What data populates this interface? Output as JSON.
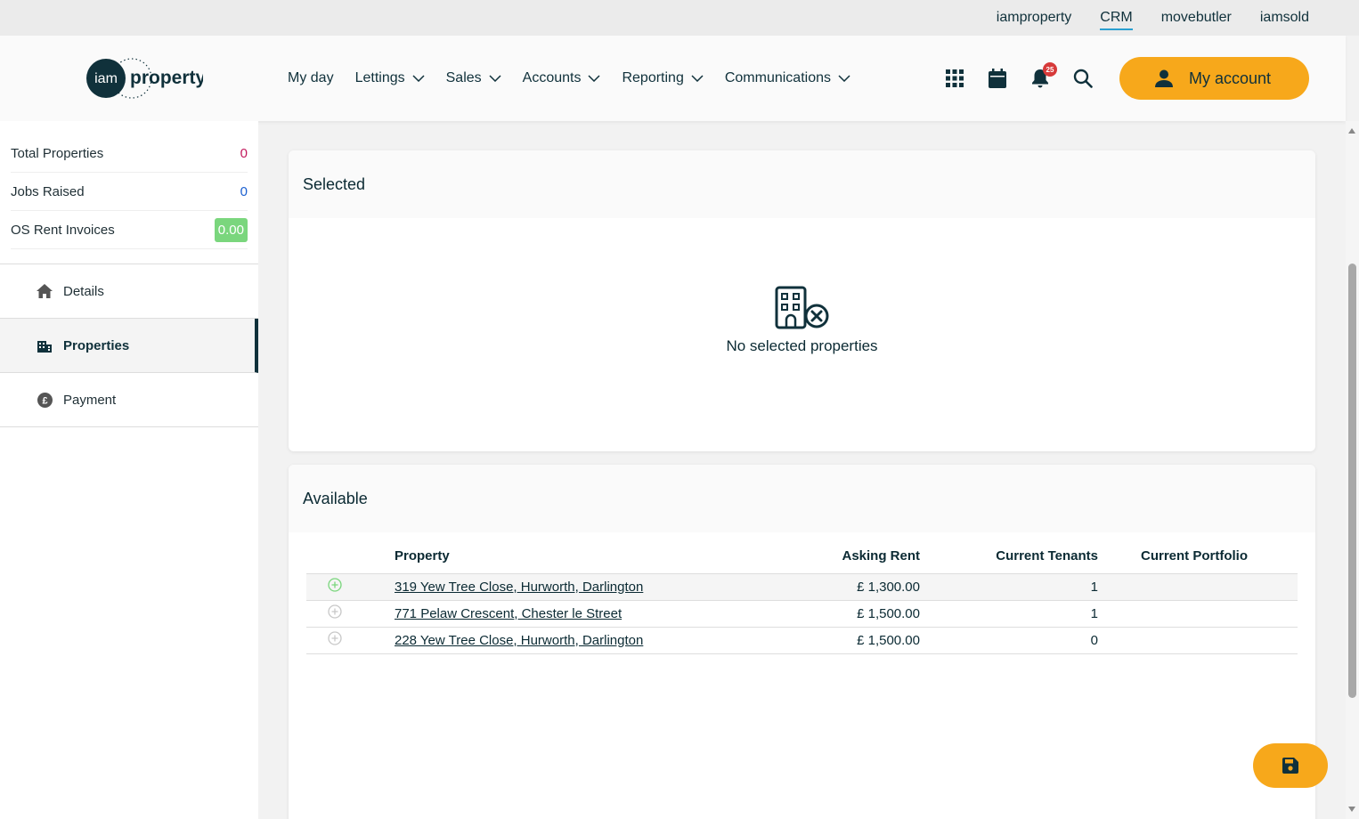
{
  "top_links": [
    {
      "label": "iamproperty",
      "active": false
    },
    {
      "label": "CRM",
      "active": true
    },
    {
      "label": "movebutler",
      "active": false
    },
    {
      "label": "iamsold",
      "active": false
    }
  ],
  "logo": {
    "part1": "iam",
    "part2": "property"
  },
  "nav": [
    {
      "label": "My day",
      "dropdown": false
    },
    {
      "label": "Lettings",
      "dropdown": true
    },
    {
      "label": "Sales",
      "dropdown": true
    },
    {
      "label": "Accounts",
      "dropdown": true
    },
    {
      "label": "Reporting",
      "dropdown": true
    },
    {
      "label": "Communications",
      "dropdown": true
    }
  ],
  "header_icons": {
    "apps": "grid-icon",
    "calendar": "calendar-icon",
    "notifications": "bell-icon",
    "notification_count": "25",
    "search": "search-icon"
  },
  "account": {
    "label": "My account",
    "icon": "user-icon"
  },
  "stats": [
    {
      "label": "Total Properties",
      "value": "0",
      "color": "#c2185b"
    },
    {
      "label": "Jobs Raised",
      "value": "0",
      "color": "#1a5fd0"
    },
    {
      "label": "OS Rent Invoices",
      "value": "0.00",
      "color": "#7ad67d"
    }
  ],
  "side_menu": [
    {
      "label": "Details",
      "icon": "home-icon",
      "active": false
    },
    {
      "label": "Properties",
      "icon": "building-icon",
      "active": true
    },
    {
      "label": "Payment",
      "icon": "pound-icon",
      "active": false
    }
  ],
  "selected": {
    "title": "Selected",
    "empty_text": "No selected properties",
    "empty_icon": "building-remove-icon"
  },
  "available": {
    "title": "Available",
    "columns": [
      "Property",
      "Asking Rent",
      "Current Tenants",
      "Current Portfolio"
    ],
    "rows": [
      {
        "property": "319 Yew Tree Close, Hurworth, Darlington",
        "rent": "£ 1,300.00",
        "tenants": "1",
        "portfolio": "",
        "highlight": true
      },
      {
        "property": "771 Pelaw Crescent, Chester le Street",
        "rent": "£ 1,500.00",
        "tenants": "1",
        "portfolio": "",
        "highlight": false
      },
      {
        "property": "228 Yew Tree Close, Hurworth, Darlington",
        "rent": "£ 1,500.00",
        "tenants": "0",
        "portfolio": "",
        "highlight": false
      }
    ]
  },
  "save_button": {
    "icon": "save-icon"
  },
  "colors": {
    "accent": "#f7a81b",
    "dark": "#10313b",
    "add_active": "#7ad67d"
  }
}
